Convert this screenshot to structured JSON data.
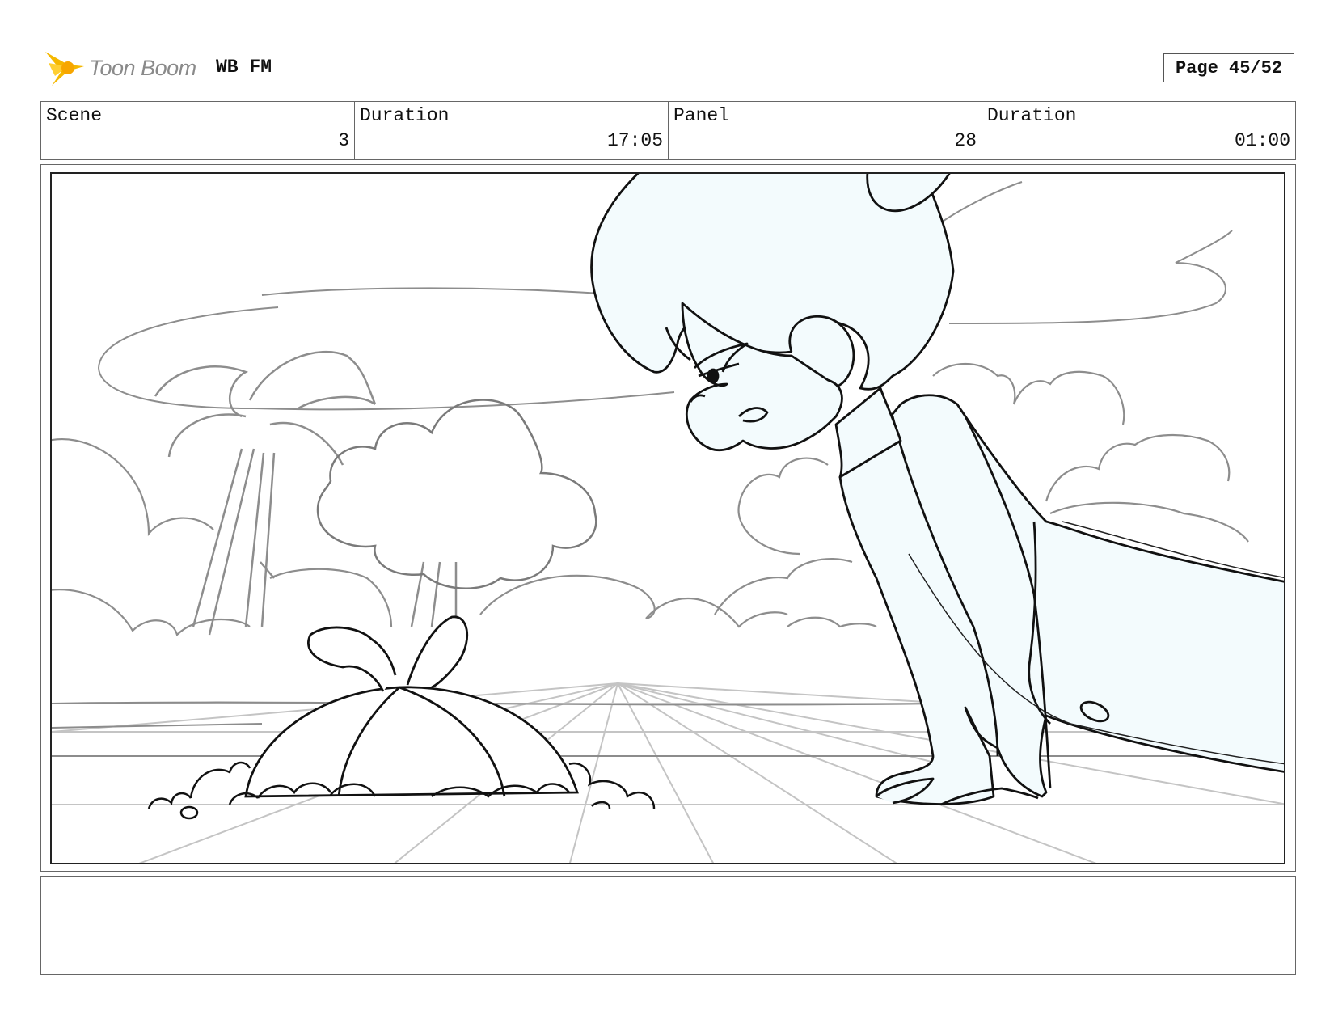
{
  "header": {
    "logo_text": "Toon Boom",
    "project": "WB FM",
    "page": "Page 45/52"
  },
  "info": {
    "scene_label": "Scene",
    "scene_value": "3",
    "scene_duration_label": "Duration",
    "scene_duration_value": "17:05",
    "panel_label": "Panel",
    "panel_value": "28",
    "panel_duration_label": "Duration",
    "panel_duration_value": "01:00"
  },
  "colors": {
    "logo_yellow": "#f5b800",
    "logo_text": "#8a8a8a",
    "skin_fill": "#f3fbfd"
  },
  "notes": ""
}
